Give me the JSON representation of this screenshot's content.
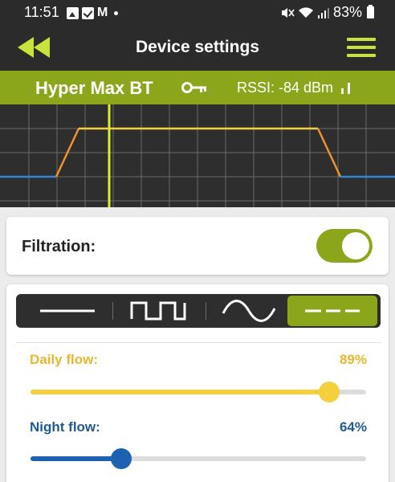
{
  "statusbar": {
    "time": "11:51",
    "notifications": [
      "image-icon",
      "check-icon",
      "mail-icon"
    ],
    "mail_glyph": "M",
    "battery_pct": "83%"
  },
  "appbar": {
    "title": "Device settings",
    "back_icon": "double-chevron-left-icon",
    "menu_icon": "hamburger-menu-icon"
  },
  "device": {
    "name": "Hyper Max BT",
    "rssi": "RSSI: -84 dBm",
    "key_icon": "key-icon",
    "signal_icon": "signal-bars-icon"
  },
  "filtration": {
    "label": "Filtration:",
    "enabled": true
  },
  "modes": {
    "items": [
      "flat-line-icon",
      "square-wave-icon",
      "sine-wave-icon",
      "dashed-line-icon"
    ],
    "selected_index": 3
  },
  "flows": {
    "daily": {
      "label": "Daily flow:",
      "value_text": "89%",
      "value": 0.89,
      "color": "#e9b62d",
      "fill": "#f5d03c"
    },
    "night": {
      "label": "Night flow:",
      "value_text": "64%",
      "value": 0.27,
      "color": "#1f5a96",
      "fill": "#1d62b0"
    }
  },
  "colors": {
    "accent": "#8ca61b",
    "accent_light": "#c8e33b",
    "dark": "#2b2b2b",
    "graph_line_orange": "#f2912f",
    "graph_line_yellow": "#f5d03c",
    "graph_line_blue": "#2f86d6"
  }
}
